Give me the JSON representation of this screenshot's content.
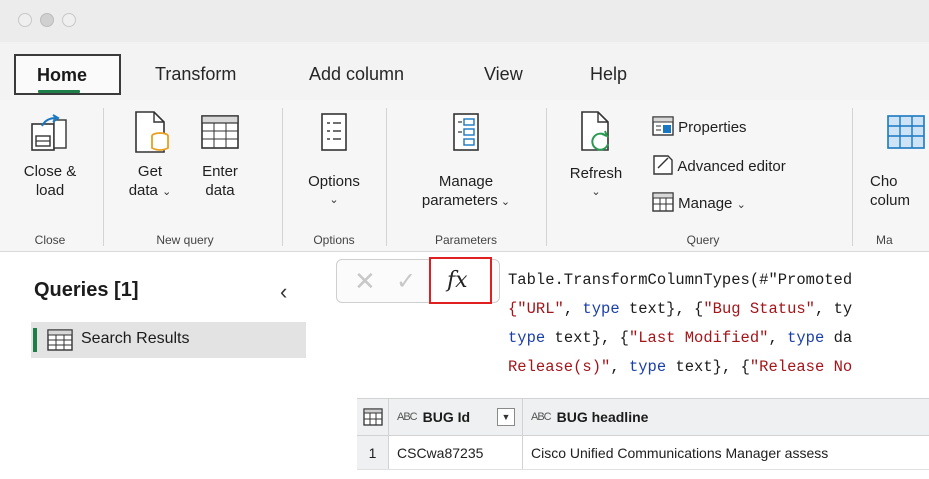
{
  "tabs": [
    {
      "label": "Home",
      "active": true
    },
    {
      "label": "Transform"
    },
    {
      "label": "Add column"
    },
    {
      "label": "View"
    },
    {
      "label": "Help"
    }
  ],
  "ribbon": {
    "close_load": {
      "line1": "Close &",
      "line2": "load"
    },
    "get_data": {
      "line1": "Get",
      "line2": "data"
    },
    "enter_data": {
      "line1": "Enter",
      "line2": "data"
    },
    "options": {
      "label": "Options"
    },
    "manage_parameters": {
      "line1": "Manage",
      "line2": "parameters"
    },
    "refresh": {
      "label": "Refresh"
    },
    "properties": "Properties",
    "advanced_editor": "Advanced editor",
    "manage": "Manage",
    "choose_columns": {
      "line1": "Cho",
      "line2": "colum"
    },
    "groups": [
      "Close",
      "New query",
      "Options",
      "Parameters",
      "Query",
      "Ma"
    ]
  },
  "queries": {
    "title": "Queries [1]",
    "items": [
      "Search Results"
    ]
  },
  "formula": {
    "fx_label": "fx",
    "lines": [
      [
        {
          "t": "Table.TransformColumnTypes(#\"Promoted",
          "c": ""
        }
      ],
      [
        {
          "t": "{\"URL\"",
          "c": "s"
        },
        {
          "t": ", ",
          "c": ""
        },
        {
          "t": "type",
          "c": "k"
        },
        {
          "t": " text}, {",
          "c": ""
        },
        {
          "t": "\"Bug Status\"",
          "c": "s"
        },
        {
          "t": ", ty",
          "c": ""
        }
      ],
      [
        {
          "t": "type",
          "c": "k"
        },
        {
          "t": " text}, {",
          "c": ""
        },
        {
          "t": "\"Last Modified\"",
          "c": "s"
        },
        {
          "t": ", ",
          "c": ""
        },
        {
          "t": "type",
          "c": "k"
        },
        {
          "t": " da",
          "c": ""
        }
      ],
      [
        {
          "t": "Release(s)\"",
          "c": "s"
        },
        {
          "t": ", ",
          "c": ""
        },
        {
          "t": "type",
          "c": "k"
        },
        {
          "t": " text}, {",
          "c": ""
        },
        {
          "t": "\"Release No",
          "c": "s"
        }
      ]
    ]
  },
  "grid": {
    "type_icon": "ABC",
    "columns": [
      "BUG Id",
      "BUG headline"
    ],
    "rows": [
      {
        "index": "1",
        "bug_id": "CSCwa87235",
        "headline": "Cisco Unified Communications Manager assess"
      }
    ]
  },
  "colors": {
    "accent": "#1e7e4a",
    "highlight": "#e02020",
    "string": "#a3151a",
    "keyword": "#1b3fa8"
  }
}
